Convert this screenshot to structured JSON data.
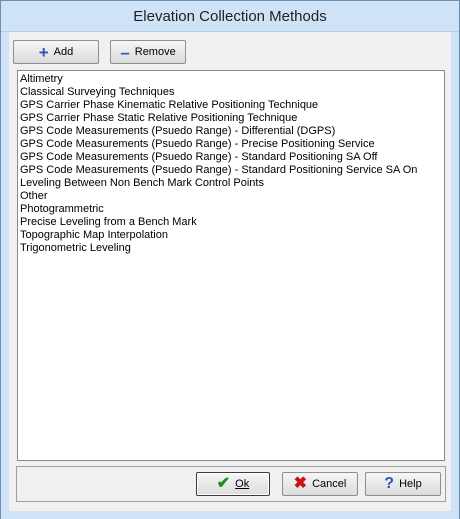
{
  "window": {
    "title": "Elevation Collection Methods"
  },
  "toolbar": {
    "add_label": "Add",
    "remove_label": "Remove",
    "add_icon": "plus-icon",
    "remove_icon": "minus-icon"
  },
  "list": {
    "items": [
      "Altimetry",
      "Classical Surveying Techniques",
      "GPS Carrier Phase Kinematic Relative Positioning Technique",
      "GPS Carrier Phase Static Relative Positioning Technique",
      "GPS Code Measurements (Psuedo Range) - Differential (DGPS)",
      "GPS Code Measurements (Psuedo Range) - Precise Positioning Service",
      "GPS Code Measurements (Psuedo Range) - Standard Positioning SA Off",
      "GPS Code Measurements (Psuedo Range) - Standard Positioning Service SA On",
      "Leveling Between Non Bench Mark Control Points",
      "Other",
      "Photogrammetric",
      "Precise Leveling from a Bench Mark",
      "Topographic Map Interpolation",
      "Trigonometric Leveling"
    ]
  },
  "footer": {
    "ok_label": "Ok",
    "cancel_label": "Cancel",
    "help_label": "Help",
    "ok_icon": "checkmark-icon",
    "cancel_icon": "x-icon",
    "help_icon": "question-mark-icon"
  },
  "colors": {
    "titlebar": "#cfe3f6",
    "accent_blue": "#2f55b8",
    "ok_green": "#1e8a1e",
    "cancel_red": "#c81414"
  }
}
